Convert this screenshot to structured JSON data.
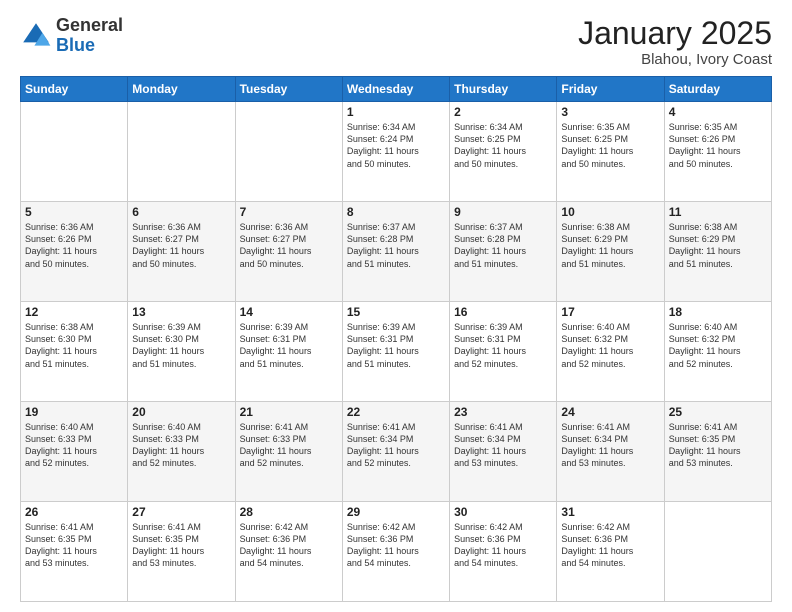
{
  "logo": {
    "general": "General",
    "blue": "Blue"
  },
  "header": {
    "month": "January 2025",
    "location": "Blahou, Ivory Coast"
  },
  "weekdays": [
    "Sunday",
    "Monday",
    "Tuesday",
    "Wednesday",
    "Thursday",
    "Friday",
    "Saturday"
  ],
  "weeks": [
    [
      {
        "day": "",
        "text": ""
      },
      {
        "day": "",
        "text": ""
      },
      {
        "day": "",
        "text": ""
      },
      {
        "day": "1",
        "text": "Sunrise: 6:34 AM\nSunset: 6:24 PM\nDaylight: 11 hours\nand 50 minutes."
      },
      {
        "day": "2",
        "text": "Sunrise: 6:34 AM\nSunset: 6:25 PM\nDaylight: 11 hours\nand 50 minutes."
      },
      {
        "day": "3",
        "text": "Sunrise: 6:35 AM\nSunset: 6:25 PM\nDaylight: 11 hours\nand 50 minutes."
      },
      {
        "day": "4",
        "text": "Sunrise: 6:35 AM\nSunset: 6:26 PM\nDaylight: 11 hours\nand 50 minutes."
      }
    ],
    [
      {
        "day": "5",
        "text": "Sunrise: 6:36 AM\nSunset: 6:26 PM\nDaylight: 11 hours\nand 50 minutes."
      },
      {
        "day": "6",
        "text": "Sunrise: 6:36 AM\nSunset: 6:27 PM\nDaylight: 11 hours\nand 50 minutes."
      },
      {
        "day": "7",
        "text": "Sunrise: 6:36 AM\nSunset: 6:27 PM\nDaylight: 11 hours\nand 50 minutes."
      },
      {
        "day": "8",
        "text": "Sunrise: 6:37 AM\nSunset: 6:28 PM\nDaylight: 11 hours\nand 51 minutes."
      },
      {
        "day": "9",
        "text": "Sunrise: 6:37 AM\nSunset: 6:28 PM\nDaylight: 11 hours\nand 51 minutes."
      },
      {
        "day": "10",
        "text": "Sunrise: 6:38 AM\nSunset: 6:29 PM\nDaylight: 11 hours\nand 51 minutes."
      },
      {
        "day": "11",
        "text": "Sunrise: 6:38 AM\nSunset: 6:29 PM\nDaylight: 11 hours\nand 51 minutes."
      }
    ],
    [
      {
        "day": "12",
        "text": "Sunrise: 6:38 AM\nSunset: 6:30 PM\nDaylight: 11 hours\nand 51 minutes."
      },
      {
        "day": "13",
        "text": "Sunrise: 6:39 AM\nSunset: 6:30 PM\nDaylight: 11 hours\nand 51 minutes."
      },
      {
        "day": "14",
        "text": "Sunrise: 6:39 AM\nSunset: 6:31 PM\nDaylight: 11 hours\nand 51 minutes."
      },
      {
        "day": "15",
        "text": "Sunrise: 6:39 AM\nSunset: 6:31 PM\nDaylight: 11 hours\nand 51 minutes."
      },
      {
        "day": "16",
        "text": "Sunrise: 6:39 AM\nSunset: 6:31 PM\nDaylight: 11 hours\nand 52 minutes."
      },
      {
        "day": "17",
        "text": "Sunrise: 6:40 AM\nSunset: 6:32 PM\nDaylight: 11 hours\nand 52 minutes."
      },
      {
        "day": "18",
        "text": "Sunrise: 6:40 AM\nSunset: 6:32 PM\nDaylight: 11 hours\nand 52 minutes."
      }
    ],
    [
      {
        "day": "19",
        "text": "Sunrise: 6:40 AM\nSunset: 6:33 PM\nDaylight: 11 hours\nand 52 minutes."
      },
      {
        "day": "20",
        "text": "Sunrise: 6:40 AM\nSunset: 6:33 PM\nDaylight: 11 hours\nand 52 minutes."
      },
      {
        "day": "21",
        "text": "Sunrise: 6:41 AM\nSunset: 6:33 PM\nDaylight: 11 hours\nand 52 minutes."
      },
      {
        "day": "22",
        "text": "Sunrise: 6:41 AM\nSunset: 6:34 PM\nDaylight: 11 hours\nand 52 minutes."
      },
      {
        "day": "23",
        "text": "Sunrise: 6:41 AM\nSunset: 6:34 PM\nDaylight: 11 hours\nand 53 minutes."
      },
      {
        "day": "24",
        "text": "Sunrise: 6:41 AM\nSunset: 6:34 PM\nDaylight: 11 hours\nand 53 minutes."
      },
      {
        "day": "25",
        "text": "Sunrise: 6:41 AM\nSunset: 6:35 PM\nDaylight: 11 hours\nand 53 minutes."
      }
    ],
    [
      {
        "day": "26",
        "text": "Sunrise: 6:41 AM\nSunset: 6:35 PM\nDaylight: 11 hours\nand 53 minutes."
      },
      {
        "day": "27",
        "text": "Sunrise: 6:41 AM\nSunset: 6:35 PM\nDaylight: 11 hours\nand 53 minutes."
      },
      {
        "day": "28",
        "text": "Sunrise: 6:42 AM\nSunset: 6:36 PM\nDaylight: 11 hours\nand 54 minutes."
      },
      {
        "day": "29",
        "text": "Sunrise: 6:42 AM\nSunset: 6:36 PM\nDaylight: 11 hours\nand 54 minutes."
      },
      {
        "day": "30",
        "text": "Sunrise: 6:42 AM\nSunset: 6:36 PM\nDaylight: 11 hours\nand 54 minutes."
      },
      {
        "day": "31",
        "text": "Sunrise: 6:42 AM\nSunset: 6:36 PM\nDaylight: 11 hours\nand 54 minutes."
      },
      {
        "day": "",
        "text": ""
      }
    ]
  ]
}
